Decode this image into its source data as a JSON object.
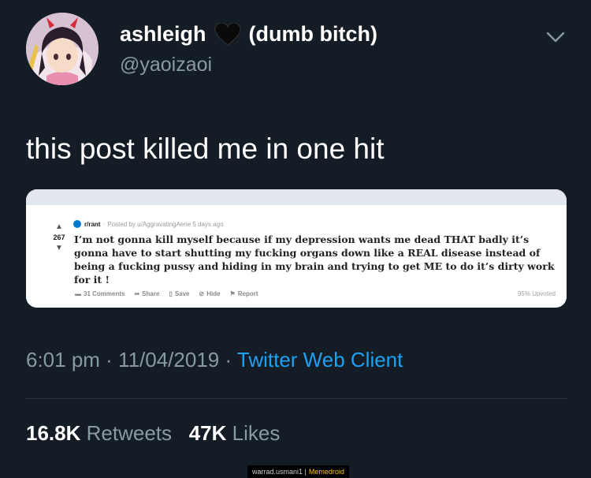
{
  "tweet": {
    "display_name": "ashleigh",
    "name_suffix": "(dumb bitch)",
    "heart_icon": "black-heart-icon",
    "handle": "@yaoizaoi",
    "text": "this post killed me in one hit",
    "timestamp": "6:01 pm · 11/04/2019 · ",
    "client": "Twitter Web Client",
    "retweets_count": "16.8K",
    "retweets_label": "Retweets",
    "likes_count": "47K",
    "likes_label": "Likes"
  },
  "reddit_post": {
    "score": "267",
    "subreddit": "r/rant",
    "posted_by": "· Posted by u/AggravatingAerie 5 days ago",
    "body": "I’m not gonna kill myself because if my depression wants me dead THAT badly it’s gonna have to start shutting my fucking organs down like a REAL disease instead of being a fucking pussy and hiding in my brain and trying to get ME to do it’s dirty work for it !",
    "actions": {
      "comments": "31 Comments",
      "share": "Share",
      "save": "Save",
      "hide": "Hide",
      "report": "Report"
    },
    "upvoted": "95% Upvoted"
  },
  "watermark": {
    "left": "warrad.usmani1 |",
    "brand": "Memedroid"
  },
  "colors": {
    "background": "#141d26",
    "secondary_text": "#8899a6",
    "link": "#1da1f2"
  }
}
